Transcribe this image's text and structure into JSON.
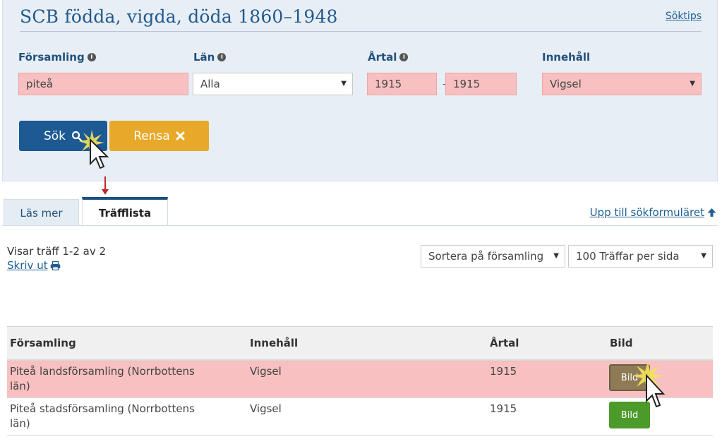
{
  "header": {
    "title": "SCB födda, vigda, döda 1860–1948",
    "tips_link": "Söktips"
  },
  "form": {
    "parish_label": "Församling",
    "parish_value": "piteå",
    "county_label": "Län",
    "county_value": "Alla",
    "year_label": "Årtal",
    "year_from": "1915",
    "year_to": "1915",
    "year_sep": "-",
    "content_label": "Innehåll",
    "content_value": "Vigsel",
    "search_label": "Sök",
    "clear_label": "Rensa"
  },
  "tabs": [
    {
      "label": "Läs mer"
    },
    {
      "label": "Träfflista"
    }
  ],
  "up_link": "Upp till sökformuläret",
  "results": {
    "summary": "Visar träff 1-2 av 2",
    "print_label": "Skriv ut",
    "sort_value": "Sortera på församling",
    "per_page_value": "100 Träffar per sida"
  },
  "table": {
    "headers": [
      "Församling",
      "Innehåll",
      "Årtal",
      "Bild"
    ],
    "rows": [
      {
        "parish_line1": "Piteå landsförsamling (Norrbottens",
        "parish_line2": "län)",
        "content": "Vigsel",
        "year": "1915",
        "image_button": "Bild"
      },
      {
        "parish_line1": "Piteå stadsförsamling (Norrbottens",
        "parish_line2": "län)",
        "content": "Vigsel",
        "year": "1915",
        "image_button": "Bild"
      }
    ]
  },
  "colors": {
    "primary": "#1d5a94",
    "warning": "#e8a82a",
    "highlight": "#f8c0c0",
    "success": "#4c9a2a",
    "panel": "#e7eef6"
  },
  "icons": [
    "info-icon",
    "search-icon",
    "close-icon",
    "chevron-down-icon",
    "arrow-up-icon",
    "print-icon",
    "cursor-icon"
  ]
}
